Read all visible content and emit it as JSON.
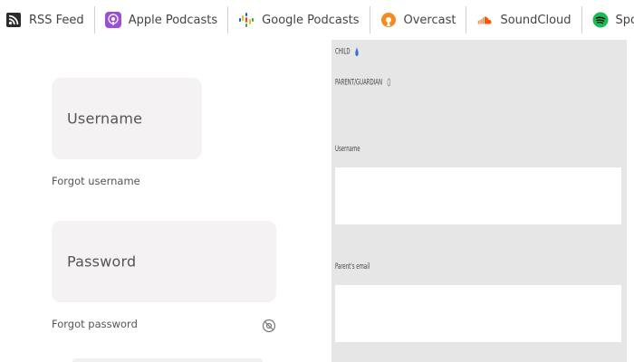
{
  "podcast_bar": {
    "items": [
      {
        "label": "RSS Feed",
        "icon": "rss-icon",
        "color": "#2b2b2b"
      },
      {
        "label": "Apple Podcasts",
        "icon": "apple-podcasts-icon",
        "color": "#9b4fd6"
      },
      {
        "label": "Google Podcasts",
        "icon": "google-podcasts-icon",
        "color": "#fbbc04"
      },
      {
        "label": "Overcast",
        "icon": "overcast-icon",
        "color": "#f58a1f"
      },
      {
        "label": "SoundCloud",
        "icon": "soundcloud-icon",
        "color": "#ff5500"
      },
      {
        "label": "Spotify",
        "icon": "spotify-icon",
        "color": "#1db954"
      }
    ]
  },
  "login": {
    "username_placeholder": "Username",
    "forgot_username": "Forgot username",
    "password_placeholder": "Password",
    "forgot_password": "Forgot password",
    "toggle_icon": "eye-slash-icon"
  },
  "signup": {
    "child_label": "CHILD",
    "parent_label": "PARENT/GUARDIAN",
    "username_label": "Username",
    "parent_email_label": "Parent's email",
    "colors": {
      "panel_bg": "#e6e6e6",
      "box_bg": "#ffffff"
    }
  }
}
